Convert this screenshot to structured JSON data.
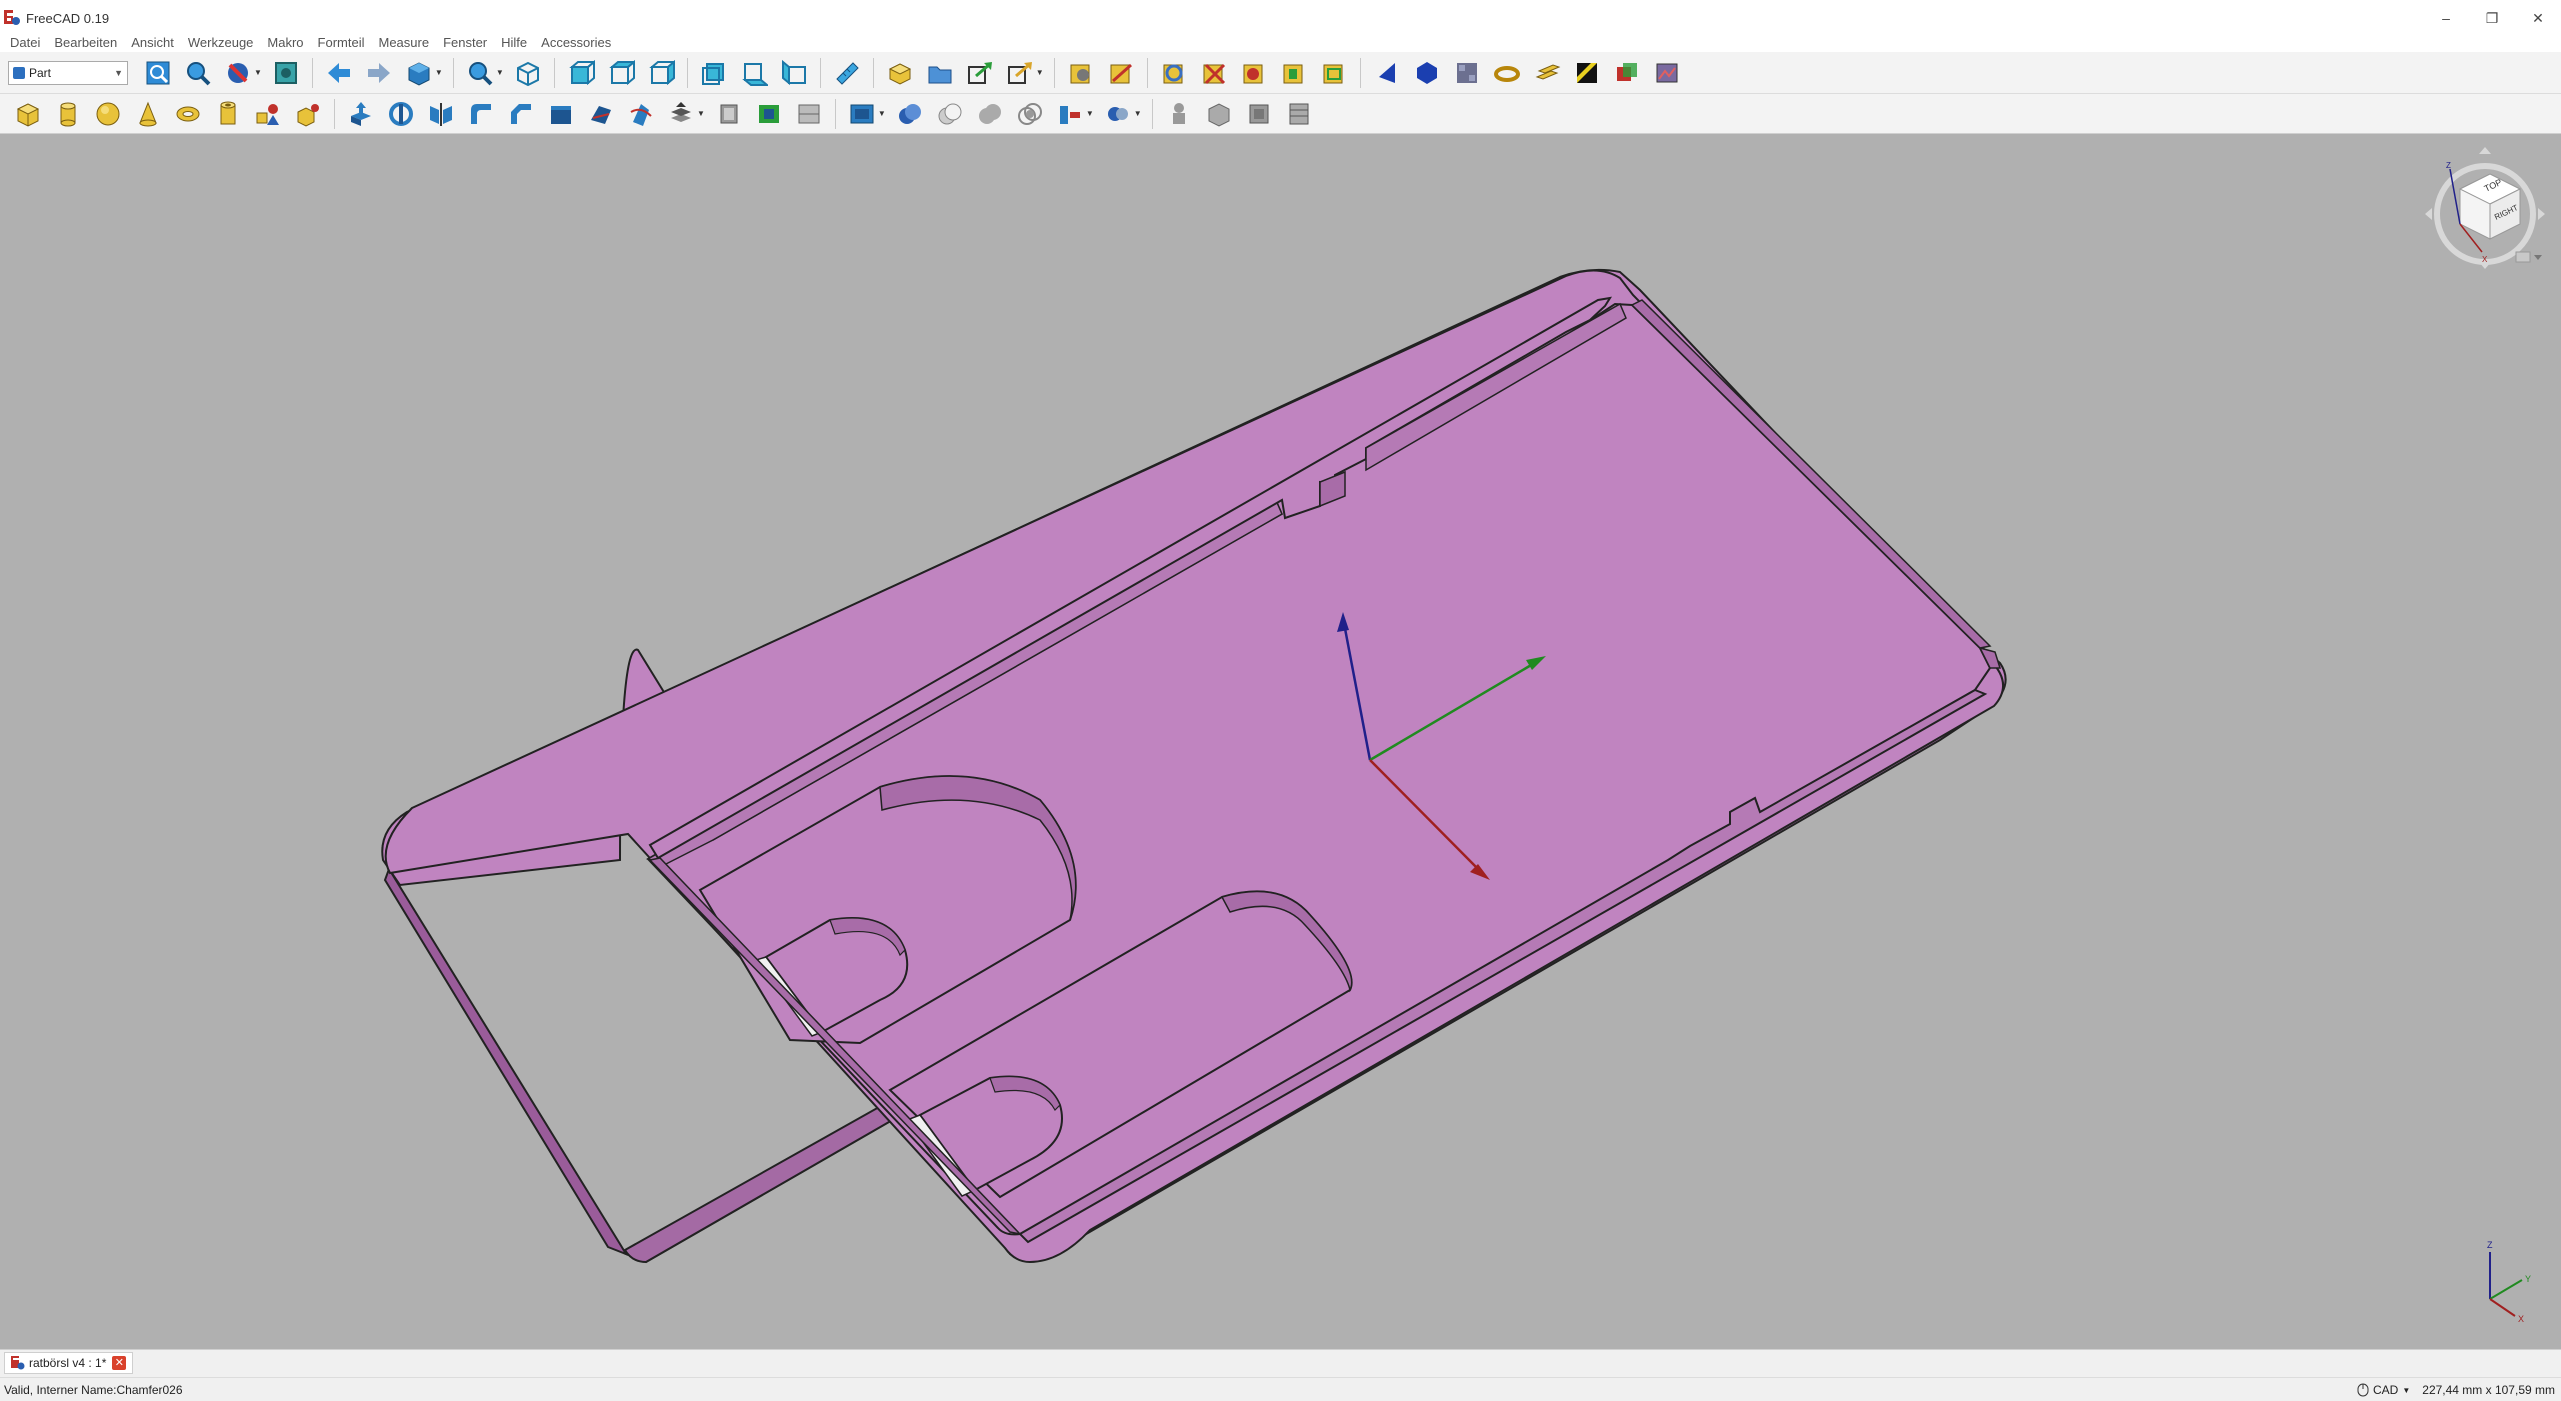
{
  "app": {
    "title": "FreeCAD 0.19"
  },
  "menu": [
    "Datei",
    "Bearbeiten",
    "Ansicht",
    "Werkzeuge",
    "Makro",
    "Formteil",
    "Measure",
    "Fenster",
    "Hilfe",
    "Accessories"
  ],
  "workbench": {
    "selected": "Part"
  },
  "navcube": {
    "top_label": "TOP",
    "right_label": "RIGHT",
    "axis_x": "X",
    "axis_y": "Y",
    "axis_z": "Z"
  },
  "mini_axis": {
    "x": "X",
    "y": "Y",
    "z": "Z"
  },
  "colors": {
    "part_fill": "#c084c0",
    "viewport_bg": "#b0b0b0",
    "axis_x": "#a02020",
    "axis_y": "#208a20",
    "axis_z": "#20208a"
  },
  "document_tab": {
    "label": "ratbörsl v4 : 1*"
  },
  "status": {
    "message": "Valid, Interner Name:Chamfer026",
    "nav_style": "CAD",
    "dimensions": "227,44 mm x 107,59 mm"
  }
}
